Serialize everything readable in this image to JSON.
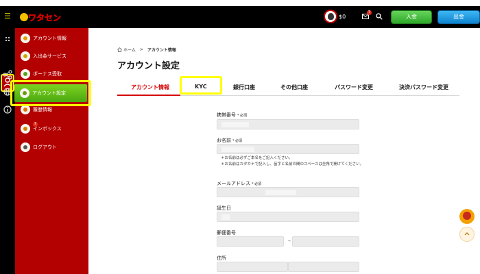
{
  "header": {
    "logo_text": "ワタセン8",
    "balance": "$0",
    "mail_badge": "7",
    "deposit_label": "入金",
    "withdraw_label": "出金"
  },
  "sidebar": {
    "items": [
      {
        "label": "アカウント情報"
      },
      {
        "label": "入出金サービス"
      },
      {
        "label": "ボーナス受取"
      },
      {
        "label": "アカウント設定"
      },
      {
        "label": "履歴情報"
      },
      {
        "label": "インボックス",
        "badge": "7"
      },
      {
        "label": "ログアウト"
      }
    ]
  },
  "breadcrumb": {
    "home": "ホーム",
    "separator": ">",
    "current": "アカウント情報"
  },
  "page": {
    "title": "アカウント設定"
  },
  "tabs": [
    {
      "label": "アカウント情報"
    },
    {
      "label": "KYC"
    },
    {
      "label": "銀行口座"
    },
    {
      "label": "その他口座"
    },
    {
      "label": "パスワード変更"
    },
    {
      "label": "決済パスワード変更"
    }
  ],
  "form": {
    "phone_label": "携帯番号",
    "required_mark": "* 必須",
    "name_label": "お名前",
    "name_note_1": "＊お名前は必ずご本名をご記入ください。",
    "name_note_2": "＊お名前はカタカナで記入し、苗字と名前の間のスペースは全角で開けてください。",
    "email_label": "メールアドレス",
    "birthday_label": "誕生日",
    "postal_label": "郵便番号",
    "postal_separator": "–",
    "address_label": "住所"
  },
  "colors": {
    "sidebar_bg": "#b30000",
    "active_green": "#6cc21a",
    "highlight": "#ffff00",
    "accent_red": "#d40000"
  }
}
